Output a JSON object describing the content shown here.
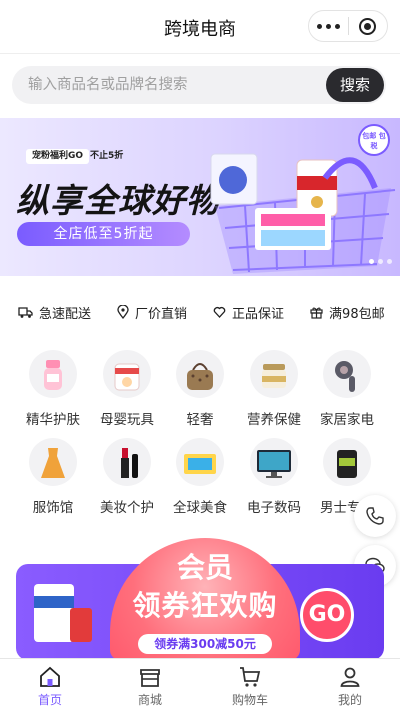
{
  "header": {
    "title": "跨境电商"
  },
  "search": {
    "placeholder": "输入商品名或品牌名搜索",
    "button_label": "搜索"
  },
  "banner": {
    "tag1": "宠粉福利GO",
    "tag2": "不止5折",
    "headline": "纵享全球好物",
    "subline": "全店低至5折起",
    "badge": "包邮 包税"
  },
  "features": [
    {
      "label": "急速配送",
      "icon": "truck-icon"
    },
    {
      "label": "厂价直销",
      "icon": "location-pin-icon"
    },
    {
      "label": "正品保证",
      "icon": "heart-shield-icon"
    },
    {
      "label": "满98包邮",
      "icon": "gift-icon"
    }
  ],
  "categories": [
    {
      "label": "精华护肤",
      "icon": "skincare-bottle-icon"
    },
    {
      "label": "母婴玩具",
      "icon": "baby-formula-icon"
    },
    {
      "label": "轻奢",
      "icon": "handbag-icon"
    },
    {
      "label": "营养保健",
      "icon": "supplement-jar-icon"
    },
    {
      "label": "家居家电",
      "icon": "hair-dryer-icon"
    },
    {
      "label": "服饰馆",
      "icon": "dress-icon"
    },
    {
      "label": "美妆个护",
      "icon": "lipstick-icon"
    },
    {
      "label": "全球美食",
      "icon": "snack-box-icon"
    },
    {
      "label": "电子数码",
      "icon": "monitor-icon"
    },
    {
      "label": "男士专区",
      "icon": "mens-care-icon"
    }
  ],
  "promo": {
    "line1": "会员",
    "line2": "领券狂欢购",
    "coupon": "领券满300减50元",
    "go": "GO"
  },
  "tabbar": [
    {
      "label": "首页",
      "icon": "home-icon",
      "active": true
    },
    {
      "label": "商城",
      "icon": "store-icon",
      "active": false
    },
    {
      "label": "购物车",
      "icon": "cart-icon",
      "active": false
    },
    {
      "label": "我的",
      "icon": "user-icon",
      "active": false
    }
  ],
  "colors": {
    "accent": "#7b5cff",
    "search_button": "#2a2a2e",
    "promo": "#ff5a6d"
  }
}
